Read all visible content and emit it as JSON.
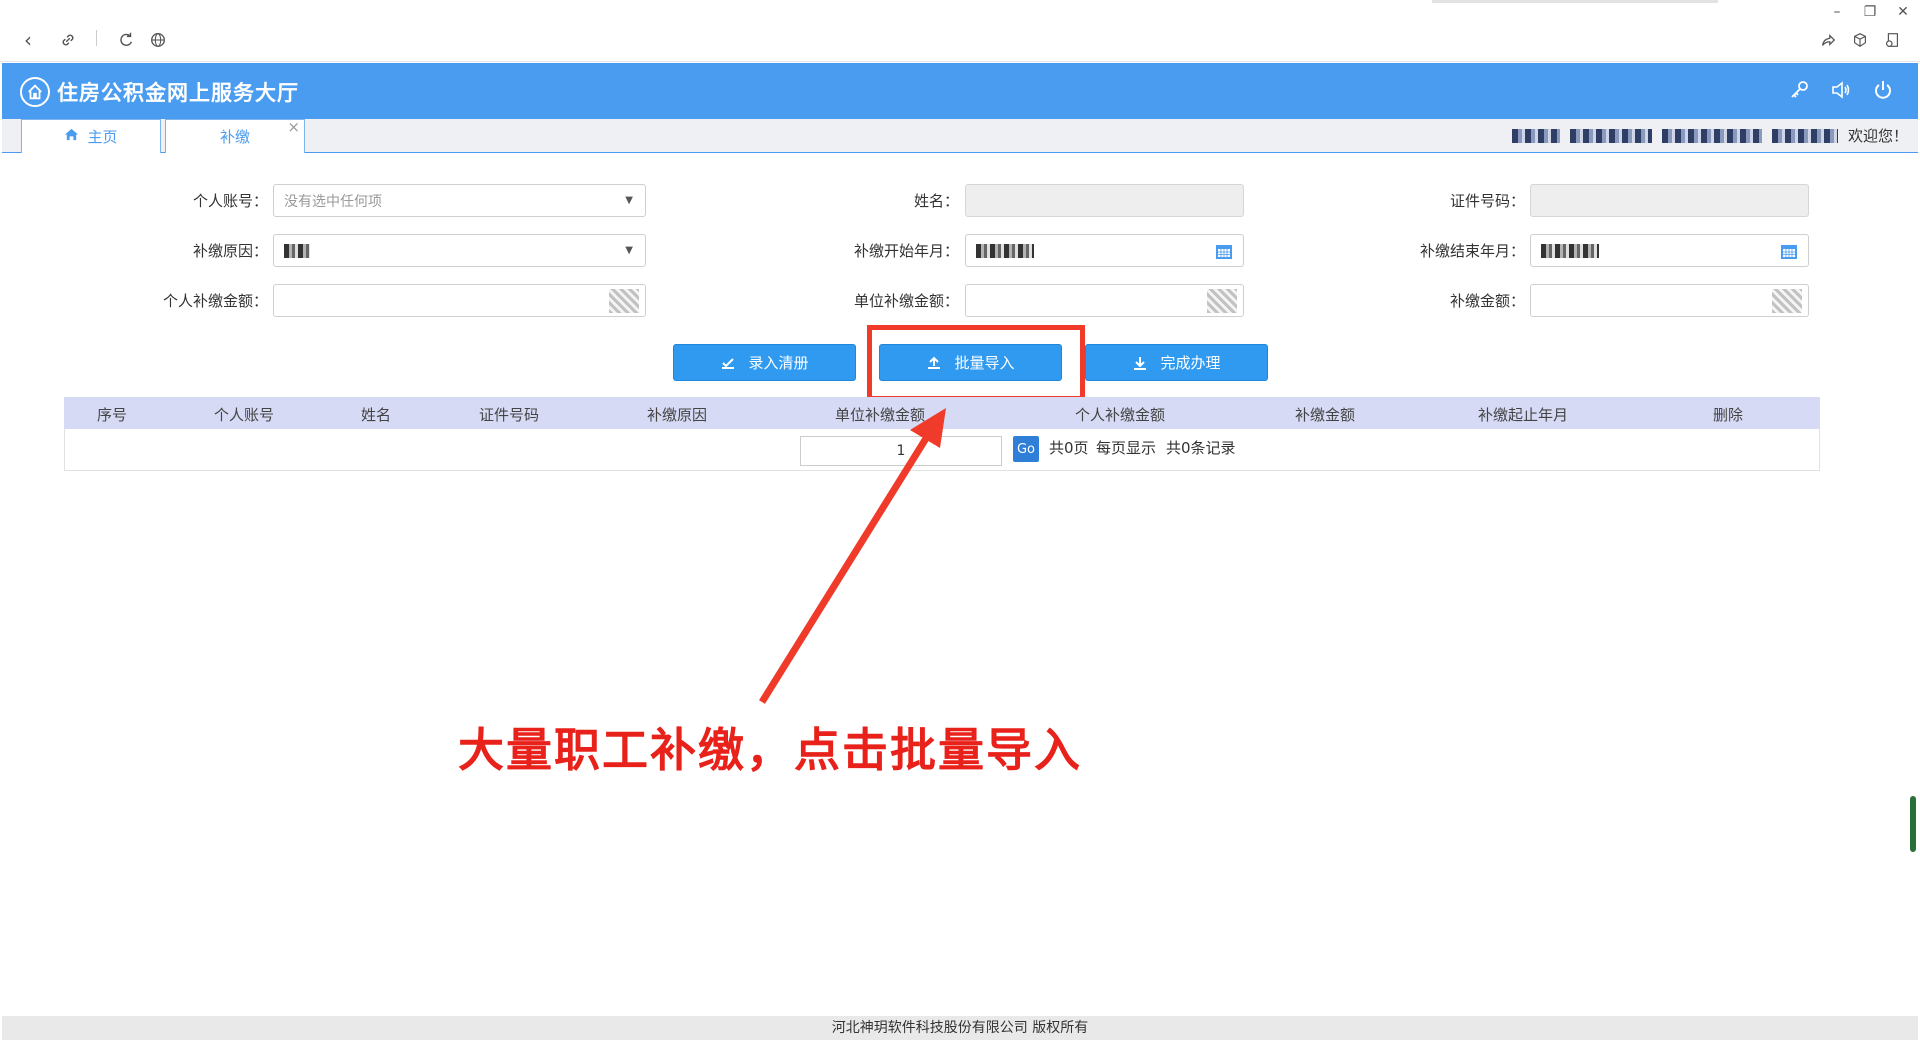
{
  "app": {
    "title": "住房公积金网上服务大厅"
  },
  "tabs": [
    {
      "label": "主页"
    },
    {
      "label": "补缴"
    }
  ],
  "header": {
    "welcome": "欢迎您！"
  },
  "form": {
    "personal_account": {
      "label": "个人账号：",
      "placeholder": "没有选中任何项"
    },
    "name": {
      "label": "姓名：",
      "value": ""
    },
    "id_number": {
      "label": "证件号码：",
      "value": ""
    },
    "reason": {
      "label": "补缴原因："
    },
    "start_month": {
      "label": "补缴开始年月："
    },
    "end_month": {
      "label": "补缴结束年月："
    },
    "personal_amount": {
      "label": "个人补缴金额："
    },
    "unit_amount": {
      "label": "单位补缴金额："
    },
    "total_amount": {
      "label": "补缴金额："
    }
  },
  "buttons": {
    "register": "录入清册",
    "batch_import": "批量导入",
    "finish": "完成办理"
  },
  "table": {
    "columns": [
      "序号",
      "个人账号",
      "姓名",
      "证件号码",
      "补缴原因",
      "单位补缴金额",
      "个人补缴金额",
      "补缴金额",
      "补缴起止年月",
      "删除"
    ],
    "rows": []
  },
  "pagination": {
    "page_input": "1",
    "go_label": "Go",
    "total_pages": "共0页",
    "per_page": "每页显示",
    "total_records": "共0条记录"
  },
  "annotation": {
    "text": "大量职工补缴，点击批量导入",
    "color": "#e8211a"
  },
  "footer": {
    "copyright": "河北神玥软件科技股份有限公司 版权所有"
  },
  "colors": {
    "header_blue": "#4a9cf0",
    "button_blue": "#2f9af0",
    "table_header": "#d6daf5",
    "highlight_red": "#f03a2a"
  }
}
